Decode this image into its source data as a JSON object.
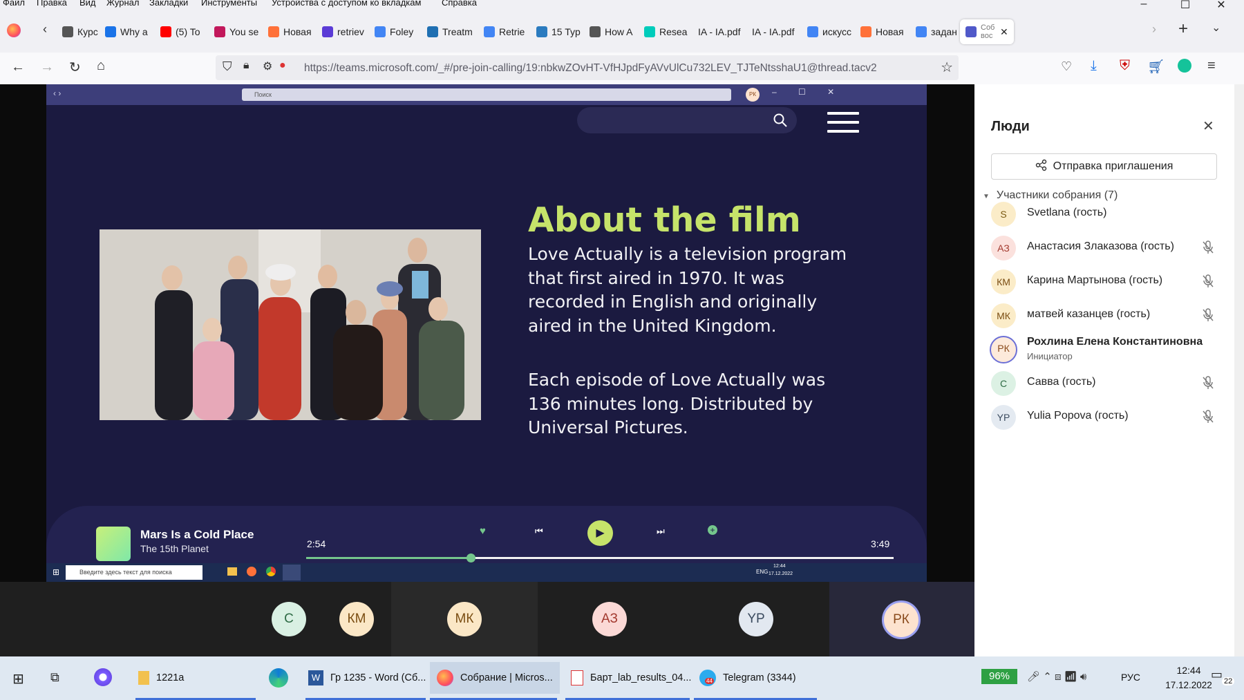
{
  "menubar": {
    "items": [
      "Файл",
      "Правка",
      "Вид",
      "Журнал",
      "Закладки",
      "Инструменты",
      "Устройства с доступом ко вкладкам",
      "Справка"
    ]
  },
  "tabs": [
    {
      "label": "Курс",
      "color": "#555555"
    },
    {
      "label": "Why a",
      "color": "#1a73e8"
    },
    {
      "label": "(5) To",
      "color": "#ff0000"
    },
    {
      "label": "You se",
      "color": "#c2185b"
    },
    {
      "label": "Новая",
      "color": "#ff7139"
    },
    {
      "label": "retriev",
      "color": "#5b3bd6"
    },
    {
      "label": "Foley",
      "color": "#4285f4"
    },
    {
      "label": "Treatm",
      "color": "#1f6fb2"
    },
    {
      "label": "Retrie",
      "color": "#4285f4"
    },
    {
      "label": "15 Typ",
      "color": "#2b7bbf"
    },
    {
      "label": "How A",
      "color": "#555555"
    },
    {
      "label": "Resea",
      "color": "#00ccbb"
    },
    {
      "label": "IA - IA.pdf",
      "color": ""
    },
    {
      "label": "IA - IA.pdf",
      "color": ""
    },
    {
      "label": "искусс",
      "color": "#4285f4"
    },
    {
      "label": "Новая",
      "color": "#ff7139"
    },
    {
      "label": "задан",
      "color": "#4285f4"
    },
    {
      "label": "Соб вос",
      "color": "#5059c9",
      "active": true
    }
  ],
  "nav": {
    "url": "https://teams.microsoft.com/_#/pre-join-calling/19:nbkwZOvHT-VfHJpdFyAVvUlCu732LEV_TJTeNtsshaU1@thread.tacv2"
  },
  "slide": {
    "teams_search_placeholder": "Поиск",
    "teams_user_initials": "РК",
    "title": "About the film",
    "paragraph1": "Love Actually is a television program that first aired in 1970. It was recorded in English and originally aired in the United Kingdom.",
    "paragraph2": "Each episode of Love Actually was 136 minutes long. Distributed by Universal Pictures.",
    "player": {
      "track": "Mars Is a Cold Place",
      "artist": "The 15th Planet",
      "elapsed": "2:54",
      "total": "3:49",
      "progress": 0.28
    },
    "inner_taskbar": {
      "search_placeholder": "Введите здесь текст для поиска",
      "lang": "ENG",
      "time": "12:44",
      "date": "17.12.2022"
    }
  },
  "strip": [
    {
      "initials": "С",
      "bg": "#d9f0e3",
      "fg": "#2e6b45"
    },
    {
      "initials": "КМ",
      "bg": "#fbe7c6",
      "fg": "#7a4d12"
    },
    {
      "initials": "МК",
      "bg": "#fbe7c6",
      "fg": "#7a4d12"
    },
    {
      "initials": "АЗ",
      "bg": "#fbd9d6",
      "fg": "#a33a2f"
    },
    {
      "initials": "YP",
      "bg": "#e2e8f0",
      "fg": "#3a4a5e"
    },
    {
      "initials": "РК",
      "bg": "#fde3cf",
      "fg": "#8a4b1d"
    }
  ],
  "panel": {
    "title": "Люди",
    "invite_label": "Отправка приглашения",
    "section_label": "Участники собрания (7)",
    "participants": [
      {
        "initials": "S",
        "name": "Svetlana (гость)",
        "bg": "#fbecc8",
        "fg": "#7a5a12",
        "muted": false
      },
      {
        "initials": "АЗ",
        "name": "Анастасия Злаказова (гость)",
        "bg": "#fbe1dd",
        "fg": "#a33a2f",
        "muted": true
      },
      {
        "initials": "КМ",
        "name": "Карина Мартынова (гость)",
        "bg": "#fbecc8",
        "fg": "#7a4d12",
        "muted": true
      },
      {
        "initials": "МК",
        "name": "матвей казанцев (гость)",
        "bg": "#fbecc8",
        "fg": "#7a4d12",
        "muted": true
      },
      {
        "initials": "РК",
        "name": "Рохлина Елена Константиновна",
        "sub": "Инициатор",
        "bg": "#fdeadb",
        "fg": "#8a4b1d",
        "muted": false,
        "bold": true
      },
      {
        "initials": "С",
        "name": "Савва (гость)",
        "bg": "#dcf1e4",
        "fg": "#2e6b45",
        "muted": true
      },
      {
        "initials": "YP",
        "name": "Yulia Popova (гость)",
        "bg": "#e4eaf1",
        "fg": "#3a4a5e",
        "muted": true
      }
    ]
  },
  "taskbar": {
    "items": [
      "1221a",
      "Гр 1235 - Word (Сб...",
      "Собрание | Micros...",
      "Барт_lab_results_04...",
      "Telegram (3344)"
    ],
    "telegram_badge": "44",
    "battery": "96%",
    "lang": "РУС",
    "time": "12:44",
    "date": "17.12.2022",
    "notifications": "22"
  }
}
